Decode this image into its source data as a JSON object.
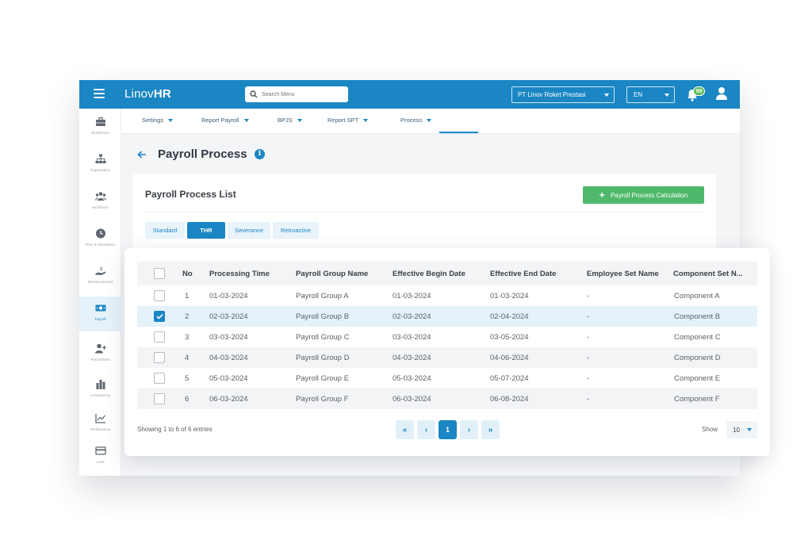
{
  "app": {
    "brand_light": "Linov",
    "brand_bold": "HR"
  },
  "search": {
    "placeholder": "Search Menu"
  },
  "header": {
    "company": "PT Linov Roket Prestasi",
    "language": "EN",
    "notifications": "99"
  },
  "colors": {
    "primary": "#1a86c3",
    "success": "#4fb86b",
    "badge": "#5bbd5a"
  },
  "sidebar": {
    "items": [
      {
        "label": "Workbench",
        "icon": "briefcase-icon"
      },
      {
        "label": "Organization",
        "icon": "org-chart-icon"
      },
      {
        "label": "Workforce",
        "icon": "people-icon"
      },
      {
        "label": "Time & Attendance",
        "icon": "clock-icon"
      },
      {
        "label": "Reimbursement",
        "icon": "hand-money-icon"
      },
      {
        "label": "Payroll",
        "icon": "money-icon",
        "active": true
      },
      {
        "label": "Recruitment",
        "icon": "user-plus-icon"
      },
      {
        "label": "Competency",
        "icon": "bar-chart-icon"
      },
      {
        "label": "Performance",
        "icon": "trend-icon"
      },
      {
        "label": "Loan",
        "icon": "card-icon"
      }
    ]
  },
  "subnav": {
    "items": [
      {
        "label": "Settings"
      },
      {
        "label": "Report Payroll"
      },
      {
        "label": "BPJS"
      },
      {
        "label": "Report SPT"
      },
      {
        "label": "Process",
        "active": true
      }
    ]
  },
  "page": {
    "title": "Payroll Process"
  },
  "list": {
    "title": "Payroll Process List",
    "calc_button": "Payroll Process Calculation",
    "tabs": [
      {
        "label": "Standard"
      },
      {
        "label": "THR",
        "active": true
      },
      {
        "label": "Severance"
      },
      {
        "label": "Retroactive"
      }
    ]
  },
  "table": {
    "columns": [
      "No",
      "Processing Time",
      "Payroll Group Name",
      "Effective Begin Date",
      "Effective End Date",
      "Employee Set Name",
      "Component Set N..."
    ],
    "rows": [
      {
        "no": "1",
        "time": "01-03-2024",
        "group": "Payroll Group A",
        "begin": "01-03-2024",
        "end": "01-03-2024",
        "emp": "-",
        "comp": "Component A",
        "checked": false
      },
      {
        "no": "2",
        "time": "02-03-2024",
        "group": "Payroll Group B",
        "begin": "02-03-2024",
        "end": "02-04-2024",
        "emp": "-",
        "comp": "Component B",
        "checked": true
      },
      {
        "no": "3",
        "time": "03-03-2024",
        "group": "Payroll Group C",
        "begin": "03-03-2024",
        "end": "03-05-2024",
        "emp": "-",
        "comp": "Component C",
        "checked": false
      },
      {
        "no": "4",
        "time": "04-03-2024",
        "group": "Payroll Group D",
        "begin": "04-03-2024",
        "end": "04-06-2024",
        "emp": "-",
        "comp": "Component D",
        "checked": false
      },
      {
        "no": "5",
        "time": "05-03-2024",
        "group": "Payroll Group E",
        "begin": "05-03-2024",
        "end": "05-07-2024",
        "emp": "-",
        "comp": "Component E",
        "checked": false
      },
      {
        "no": "6",
        "time": "06-03-2024",
        "group": "Payroll Group F",
        "begin": "06-03-2024",
        "end": "06-08-2024",
        "emp": "-",
        "comp": "Component F",
        "checked": false
      }
    ]
  },
  "pagination": {
    "entries_text": "Showing 1 to 6 of 6 entries",
    "first": "«",
    "prev": "‹",
    "current_page": "1",
    "next": "›",
    "last": "»",
    "show_label": "Show",
    "page_size": "10"
  }
}
